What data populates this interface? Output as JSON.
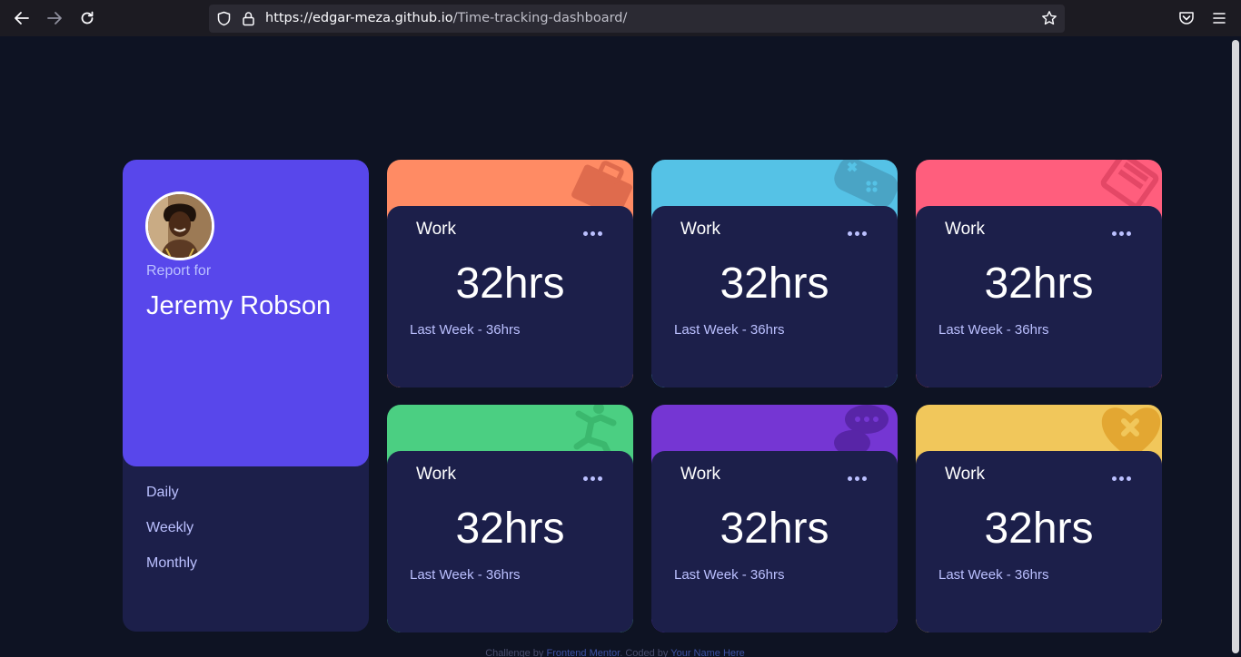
{
  "browser": {
    "url_host": "https://edgar-meza.github.io",
    "url_path": "/Time-tracking-dashboard/"
  },
  "profile": {
    "report_for": "Report for",
    "name": "Jeremy Robson",
    "periods": [
      "Daily",
      "Weekly",
      "Monthly"
    ]
  },
  "tiles": [
    {
      "title": "Work",
      "hours": "32hrs",
      "previous": "Last Week - 36hrs",
      "color": "#ff8b64",
      "icon": "briefcase-icon"
    },
    {
      "title": "Work",
      "hours": "32hrs",
      "previous": "Last Week - 36hrs",
      "color": "#55c2e6",
      "icon": "gamepad-icon"
    },
    {
      "title": "Work",
      "hours": "32hrs",
      "previous": "Last Week - 36hrs",
      "color": "#ff5e7d",
      "icon": "book-icon"
    },
    {
      "title": "Work",
      "hours": "32hrs",
      "previous": "Last Week - 36hrs",
      "color": "#4bcf82",
      "icon": "runner-icon"
    },
    {
      "title": "Work",
      "hours": "32hrs",
      "previous": "Last Week - 36hrs",
      "color": "#7536d3",
      "icon": "chat-icon"
    },
    {
      "title": "Work",
      "hours": "32hrs",
      "previous": "Last Week - 36hrs",
      "color": "#f1c75b",
      "icon": "heart-icon"
    }
  ],
  "colors": {
    "background": "#0e1323",
    "card": "#1c1f4a",
    "profile_accent": "#5847eb",
    "muted_text": "#bbc0ff"
  },
  "attribution": {
    "prefix": "Challenge by",
    "challenge_link": "Frontend Mentor",
    "middle": ". Coded by",
    "author_link": "Your Name Here"
  }
}
